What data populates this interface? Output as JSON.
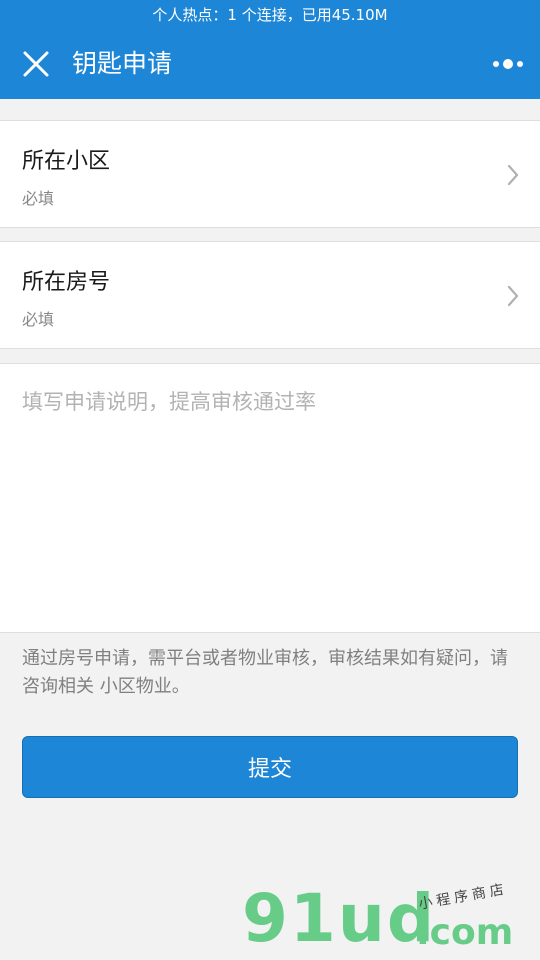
{
  "status_bar": {
    "text": "个人热点：1 个连接，已用45.10M"
  },
  "navbar": {
    "title": "钥匙申请"
  },
  "rows": [
    {
      "label": "所在小区",
      "hint": "必填"
    },
    {
      "label": "所在房号",
      "hint": "必填"
    }
  ],
  "description": {
    "placeholder": "填写申请说明，提高审核通过率",
    "value": ""
  },
  "notice": "通过房号申请，需平台或者物业审核，审核结果如有疑问，请咨询相关 小区物业。",
  "submit_label": "提交",
  "watermark": {
    "main": "91ud",
    "domain": ".com",
    "tagline": "小程序商店"
  },
  "colors": {
    "primary": "#1e86d6",
    "background": "#f2f2f2",
    "watermark": "#66cc88"
  }
}
